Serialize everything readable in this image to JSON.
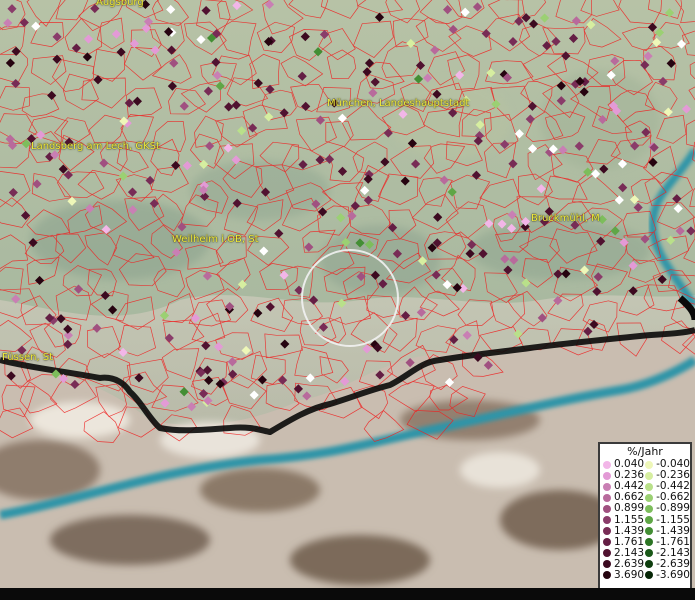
{
  "places": [
    {
      "id": "augsburg",
      "label": "Augsburg"
    },
    {
      "id": "muenchen",
      "label": "München, Landeshauptstadt"
    },
    {
      "id": "landsberg",
      "label": "Landsberg am Lech, GKSt"
    },
    {
      "id": "weilheim",
      "label": "Weilheim i.OB, St"
    },
    {
      "id": "bruckmuehl",
      "label": "Bruckmühl, M"
    },
    {
      "id": "fuessen",
      "label": "Füssen, St"
    }
  ],
  "legend": {
    "title": "%/Jahr",
    "positive": [
      {
        "label": "0.040",
        "color": "#f2b6e8"
      },
      {
        "label": "0.236",
        "color": "#e39ad6"
      },
      {
        "label": "0.442",
        "color": "#c97fb4"
      },
      {
        "label": "0.662",
        "color": "#b86a9c"
      },
      {
        "label": "0.899",
        "color": "#a05080"
      },
      {
        "label": "1.155",
        "color": "#8a3c6a"
      },
      {
        "label": "1.439",
        "color": "#782c56"
      },
      {
        "label": "1.761",
        "color": "#641e44"
      },
      {
        "label": "2.143",
        "color": "#501230"
      },
      {
        "label": "2.639",
        "color": "#3c0a20"
      },
      {
        "label": "3.690",
        "color": "#260410"
      }
    ],
    "negative": [
      {
        "label": "-0.040",
        "color": "#eef7b8"
      },
      {
        "label": "-0.236",
        "color": "#d6eea0"
      },
      {
        "label": "-0.442",
        "color": "#b9e08a"
      },
      {
        "label": "-0.662",
        "color": "#9bd073"
      },
      {
        "label": "-0.899",
        "color": "#7dbd5c"
      },
      {
        "label": "-1.155",
        "color": "#5fa646"
      },
      {
        "label": "-1.439",
        "color": "#438e34"
      },
      {
        "label": "-1.761",
        "color": "#2c7424"
      },
      {
        "label": "-2.143",
        "color": "#1a5818"
      },
      {
        "label": "-2.639",
        "color": "#0e3e0e"
      },
      {
        "label": "-3.690",
        "color": "#062606"
      }
    ]
  }
}
